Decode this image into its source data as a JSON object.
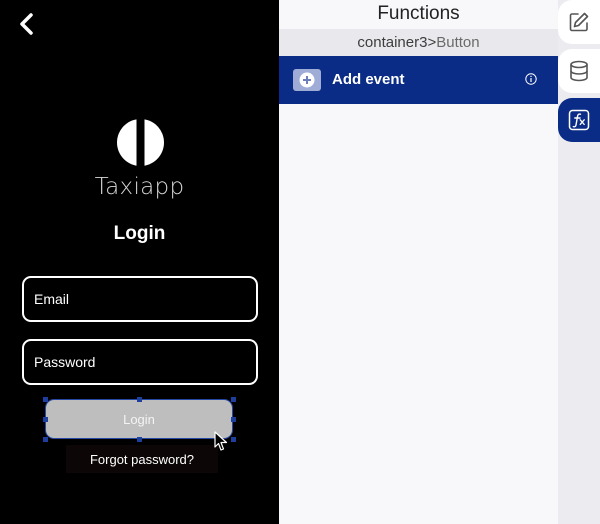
{
  "preview": {
    "app_name": "Taxiapp",
    "screen_title": "Login",
    "email_placeholder": "Email",
    "password_placeholder": "Password",
    "login_label": "Login",
    "forgot_label": "Forgot password?"
  },
  "functions": {
    "title": "Functions",
    "breadcrumb": {
      "parent": "container3",
      "separator": ">",
      "current": "Button"
    },
    "add_event_label": "Add event"
  },
  "toolbar": {
    "tabs": [
      {
        "icon": "edit-icon",
        "active": false
      },
      {
        "icon": "database-icon",
        "active": false
      },
      {
        "icon": "function-icon",
        "active": true
      }
    ]
  },
  "colors": {
    "accent": "#0b2c86",
    "preview_bg": "#000000",
    "button_gray": "#bebebe",
    "selection": "#1f3f9e"
  }
}
